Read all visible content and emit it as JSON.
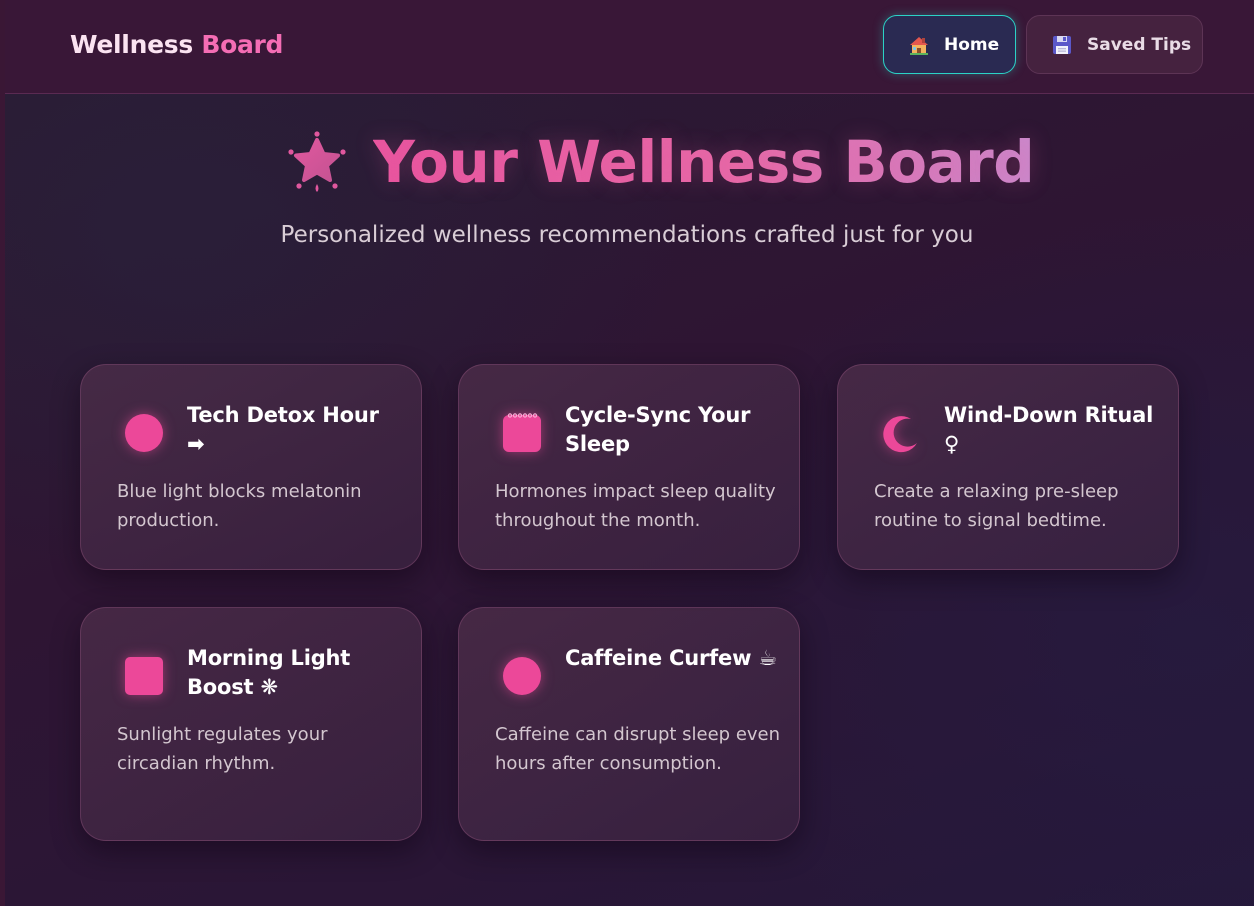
{
  "header": {
    "brand_part1": "Wellness",
    "brand_part2": "Board",
    "nav": [
      {
        "label": "Home",
        "icon": "house-icon",
        "active": true
      },
      {
        "label": "Saved Tips",
        "icon": "floppy-disk-icon",
        "active": false
      }
    ]
  },
  "hero": {
    "icon": "sparkle-star-icon",
    "title": "Your Wellness Board",
    "subtitle": "Personalized wellness recommendations crafted just for you"
  },
  "cards": [
    {
      "icon": "circle-icon",
      "title": "Tech Detox Hour ➡",
      "description": "Blue light blocks melatonin production."
    },
    {
      "icon": "calendar-icon",
      "title": "Cycle-Sync Your Sleep",
      "description": "Hormones impact sleep quality throughout the month."
    },
    {
      "icon": "crescent-moon-icon",
      "title": "Wind-Down Ritual ♀",
      "description": "Create a relaxing pre-sleep routine to signal bedtime."
    },
    {
      "icon": "square-icon",
      "title": "Morning Light Boost ❋",
      "description": "Sunlight regulates your circadian rhythm."
    },
    {
      "icon": "circle-icon",
      "title": "Caffeine Curfew ☕",
      "description": "Caffeine can disrupt sleep even hours after consumption."
    }
  ],
  "colors": {
    "accent_pink": "#ec4899",
    "brand_pink": "#f46db4",
    "active_border_teal": "#2bd2c6",
    "header_bg": "#391737"
  }
}
